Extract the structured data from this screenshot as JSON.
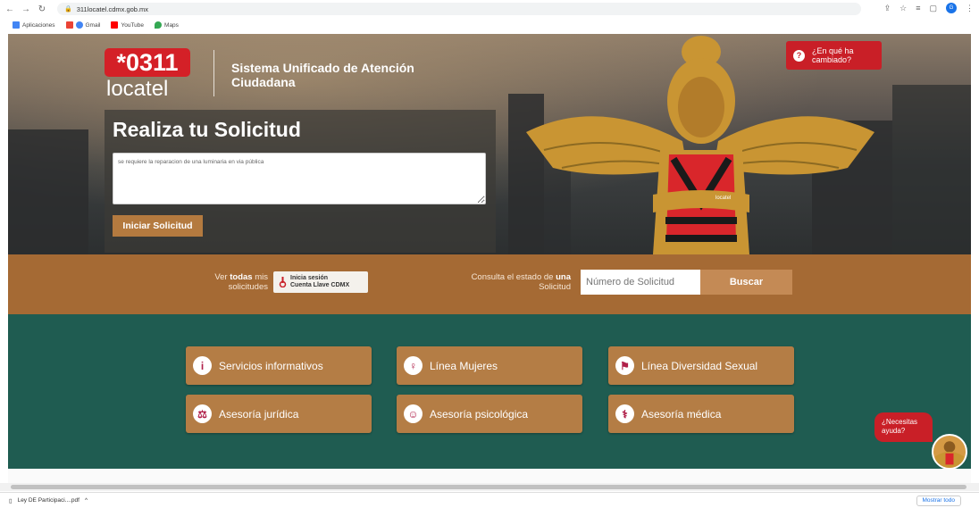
{
  "browser": {
    "url": "311locatel.cdmx.gob.mx",
    "bookmarks": [
      "Aplicaciones",
      "Gmail",
      "YouTube",
      "Maps"
    ],
    "profile_initial": "G"
  },
  "header": {
    "logo_number": "*0311",
    "logo_brand": "locatel",
    "system_title": "Sistema Unificado de Atención Ciudadana",
    "whats_changed": "¿En qué ha cambiado?"
  },
  "request": {
    "heading": "Realiza tu Solicitud",
    "input_value": "se requiere la reparacion de una luminaria en via pública",
    "start_button": "Iniciar Solicitud"
  },
  "band": {
    "see_all_prefix": "Ver ",
    "see_all_bold": "todas",
    "see_all_suffix": " mis solicitudes",
    "login_line1": "Inicia sesión",
    "login_line2": "Cuenta Llave CDMX",
    "status_prefix": "Consulta el estado de ",
    "status_bold": "una",
    "status_suffix": " Solicitud",
    "search_placeholder": "Número de Solicitud",
    "search_button": "Buscar"
  },
  "services": [
    {
      "label": "Servicios informativos",
      "icon": "info-icon"
    },
    {
      "label": "Línea Mujeres",
      "icon": "female-icon"
    },
    {
      "label": "Línea Diversidad Sexual",
      "icon": "diversity-icon"
    },
    {
      "label": "Asesoría jurídica",
      "icon": "scales-icon"
    },
    {
      "label": "Asesoría psicológica",
      "icon": "head-icon"
    },
    {
      "label": "Asesoría médica",
      "icon": "stethoscope-icon"
    }
  ],
  "chat": {
    "need_help": "¿Necesitas ayuda?"
  },
  "downloads": {
    "file": "Ley DE Participaci....pdf",
    "show_all": "Mostrar todo"
  },
  "colors": {
    "red": "#c91f27",
    "gold": "#b47d45",
    "green": "#1f5c51",
    "band": "#a56a34"
  }
}
